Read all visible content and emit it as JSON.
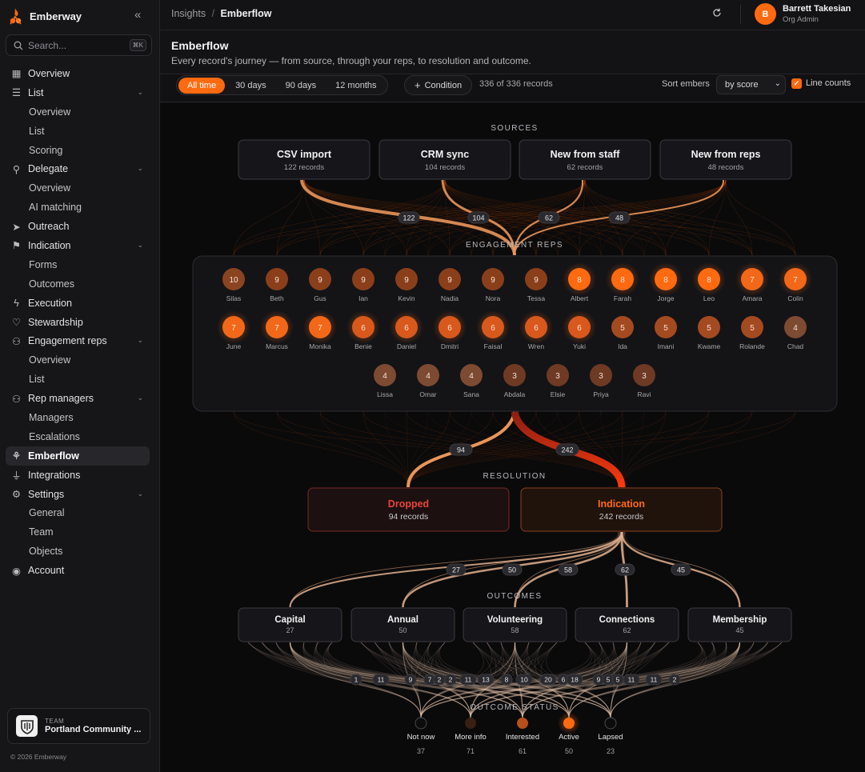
{
  "app": {
    "name": "Emberway",
    "copyright": "© 2026 Emberway"
  },
  "search": {
    "placeholder": "Search...",
    "shortcut": "⌘K"
  },
  "sidebar": {
    "items": [
      {
        "label": "Overview",
        "icon": "grid-icon",
        "type": "top"
      },
      {
        "label": "List",
        "icon": "list-icon",
        "type": "top",
        "expand": true
      },
      {
        "label": "Overview",
        "type": "sub"
      },
      {
        "label": "List",
        "type": "sub"
      },
      {
        "label": "Scoring",
        "type": "sub"
      },
      {
        "label": "Delegate",
        "icon": "person-branch-icon",
        "type": "top",
        "expand": true
      },
      {
        "label": "Overview",
        "type": "sub"
      },
      {
        "label": "AI matching",
        "type": "sub"
      },
      {
        "label": "Outreach",
        "icon": "send-icon",
        "type": "top"
      },
      {
        "label": "Indication",
        "icon": "flag-icon",
        "type": "top",
        "expand": true
      },
      {
        "label": "Forms",
        "type": "sub"
      },
      {
        "label": "Outcomes",
        "type": "sub"
      },
      {
        "label": "Execution",
        "icon": "bolt-icon",
        "type": "top"
      },
      {
        "label": "Stewardship",
        "icon": "heart-icon",
        "type": "top"
      },
      {
        "label": "Engagement reps",
        "icon": "users-icon",
        "type": "top",
        "expand": true
      },
      {
        "label": "Overview",
        "type": "sub"
      },
      {
        "label": "List",
        "type": "sub"
      },
      {
        "label": "Rep managers",
        "icon": "user-group-icon",
        "type": "top",
        "expand": true
      },
      {
        "label": "Managers",
        "type": "sub"
      },
      {
        "label": "Escalations",
        "type": "sub"
      },
      {
        "label": "Emberflow",
        "icon": "flow-icon",
        "type": "top",
        "active": true
      },
      {
        "label": "Integrations",
        "icon": "plug-icon",
        "type": "top"
      },
      {
        "label": "Settings",
        "icon": "gear-icon",
        "type": "top",
        "expand": true
      },
      {
        "label": "General",
        "type": "sub"
      },
      {
        "label": "Team",
        "type": "sub"
      },
      {
        "label": "Objects",
        "type": "sub"
      },
      {
        "label": "Account",
        "icon": "account-icon",
        "type": "top"
      }
    ]
  },
  "team": {
    "caption": "TEAM",
    "name": "Portland Community ..."
  },
  "breadcrumb": {
    "parent": "Insights",
    "sep": "/",
    "current": "Emberflow"
  },
  "user": {
    "initial": "B",
    "name": "Barrett Takesian",
    "role": "Org Admin"
  },
  "page": {
    "title": "Emberflow",
    "subtitle": "Every record's journey — from source, through your reps, to resolution and outcome."
  },
  "filters": {
    "ranges": [
      "All time",
      "30 days",
      "90 days",
      "12 months"
    ],
    "active_range": "All time",
    "condition": "Condition",
    "count": "336 of 336 records",
    "sort_label": "Sort embers",
    "sort_value": "by score",
    "line_counts": "Line counts"
  },
  "flow": {
    "sections": {
      "sources": "SOURCES",
      "reps": "ENGAGEMENT REPS",
      "resolution": "RESOLUTION",
      "outcomes": "OUTCOMES",
      "status": "OUTCOME STATUS"
    },
    "sources": [
      {
        "name": "CSV import",
        "sub": "122 records",
        "count": "122"
      },
      {
        "name": "CRM sync",
        "sub": "104 records",
        "count": "104"
      },
      {
        "name": "New from staff",
        "sub": "62 records",
        "count": "62"
      },
      {
        "name": "New from reps",
        "sub": "48 records",
        "count": "48"
      }
    ],
    "reps": [
      {
        "name": "Silas",
        "score": 10
      },
      {
        "name": "Beth",
        "score": 9
      },
      {
        "name": "Gus",
        "score": 9
      },
      {
        "name": "Ian",
        "score": 9
      },
      {
        "name": "Kevin",
        "score": 9
      },
      {
        "name": "Nadia",
        "score": 9
      },
      {
        "name": "Nora",
        "score": 9
      },
      {
        "name": "Tessa",
        "score": 9
      },
      {
        "name": "Albert",
        "score": 8
      },
      {
        "name": "Farah",
        "score": 8
      },
      {
        "name": "Jorge",
        "score": 8
      },
      {
        "name": "Leo",
        "score": 8
      },
      {
        "name": "Amara",
        "score": 7
      },
      {
        "name": "Colin",
        "score": 7
      },
      {
        "name": "June",
        "score": 7
      },
      {
        "name": "Marcus",
        "score": 7
      },
      {
        "name": "Monika",
        "score": 7
      },
      {
        "name": "Benie",
        "score": 6
      },
      {
        "name": "Daniel",
        "score": 6
      },
      {
        "name": "Dmitri",
        "score": 6
      },
      {
        "name": "Faisal",
        "score": 6
      },
      {
        "name": "Wren",
        "score": 6
      },
      {
        "name": "Yuki",
        "score": 6
      },
      {
        "name": "Ida",
        "score": 5
      },
      {
        "name": "Imani",
        "score": 5
      },
      {
        "name": "Kwame",
        "score": 5
      },
      {
        "name": "Rolande",
        "score": 5
      },
      {
        "name": "Chad",
        "score": 4
      },
      {
        "name": "Lissa",
        "score": 4
      },
      {
        "name": "Omar",
        "score": 4
      },
      {
        "name": "Sana",
        "score": 4
      },
      {
        "name": "Abdala",
        "score": 3
      },
      {
        "name": "Elsie",
        "score": 3
      },
      {
        "name": "Priya",
        "score": 3
      },
      {
        "name": "Ravi",
        "score": 3
      }
    ],
    "resolution": [
      {
        "name": "Dropped",
        "sub": "94 records",
        "count": "94",
        "color": "#e8443a"
      },
      {
        "name": "Indication",
        "sub": "242 records",
        "count": "242",
        "color": "#ff6a10"
      }
    ],
    "outcomes": [
      {
        "name": "Capital",
        "sub": "27",
        "count": "27"
      },
      {
        "name": "Annual",
        "sub": "50",
        "count": "50"
      },
      {
        "name": "Volunteering",
        "sub": "58",
        "count": "58"
      },
      {
        "name": "Connections",
        "sub": "62",
        "count": "62"
      },
      {
        "name": "Membership",
        "sub": "45",
        "count": "45"
      }
    ],
    "bottom_counts": [
      "1",
      "11",
      "9",
      "7",
      "2",
      "2",
      "11",
      "13",
      "8",
      "10",
      "20",
      "6",
      "18",
      "9",
      "5",
      "5",
      "11",
      "11",
      "2"
    ],
    "statuses": [
      {
        "name": "Not now",
        "count": "37",
        "color": "#0c0c0d"
      },
      {
        "name": "More info",
        "count": "71",
        "color": "#3a1f12"
      },
      {
        "name": "Interested",
        "count": "61",
        "color": "#b64f1a"
      },
      {
        "name": "Active",
        "count": "50",
        "color": "#ff6a10"
      },
      {
        "name": "Lapsed",
        "count": "23",
        "color": "#0c0c0d"
      }
    ]
  }
}
